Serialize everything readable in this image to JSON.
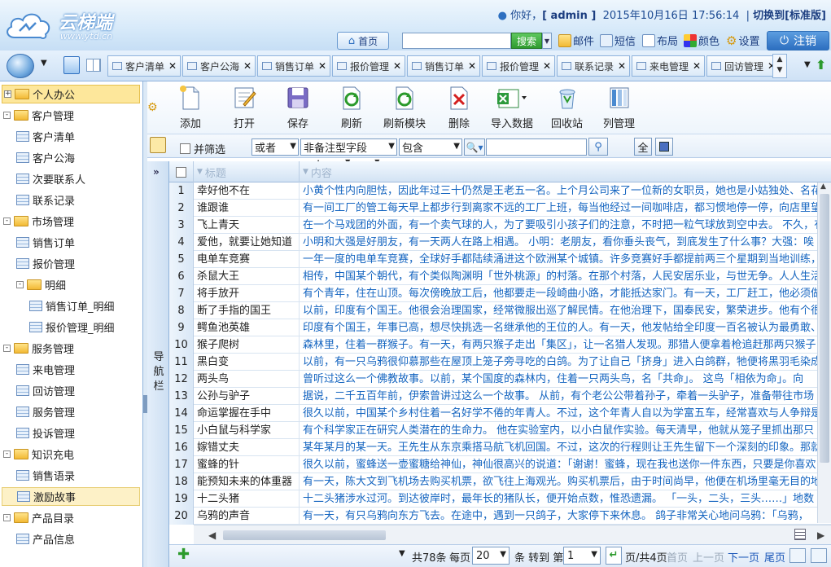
{
  "header": {
    "brand": "云梯端",
    "brand_url": "www.ytd.cn",
    "greeting": "你好，",
    "user": "[ admin ]",
    "datetime": "2015年10月16日 17:56:14",
    "switch_edition": "切换到[标准版]",
    "home": "首页",
    "search_placeholder": "",
    "search_button": "搜索",
    "mail": "邮件",
    "sms": "短信",
    "layout": "布局",
    "color": "颜色",
    "settings": "设置",
    "logout": "注销"
  },
  "tabs": [
    "客户清单",
    "客户公海",
    "销售订单",
    "报价管理",
    "销售订单",
    "报价管理",
    "联系记录",
    "来电管理",
    "回访管理"
  ],
  "sidebar": {
    "items": [
      {
        "label": "个人办公",
        "type": "folder",
        "level": 0,
        "expander": "+",
        "selected": true
      },
      {
        "label": "客户管理",
        "type": "folder",
        "level": 0,
        "expander": "-"
      },
      {
        "label": "客户清单",
        "type": "page",
        "level": 1
      },
      {
        "label": "客户公海",
        "type": "page",
        "level": 1
      },
      {
        "label": "次要联系人",
        "type": "page",
        "level": 1
      },
      {
        "label": "联系记录",
        "type": "page",
        "level": 1
      },
      {
        "label": "市场管理",
        "type": "folder",
        "level": 0,
        "expander": "-"
      },
      {
        "label": "销售订单",
        "type": "page",
        "level": 1
      },
      {
        "label": "报价管理",
        "type": "page",
        "level": 1
      },
      {
        "label": "明细",
        "type": "folder",
        "level": 1,
        "expander": "-"
      },
      {
        "label": "销售订单_明细",
        "type": "page",
        "level": 2
      },
      {
        "label": "报价管理_明细",
        "type": "page",
        "level": 2
      },
      {
        "label": "服务管理",
        "type": "folder",
        "level": 0,
        "expander": "-"
      },
      {
        "label": "来电管理",
        "type": "page",
        "level": 1
      },
      {
        "label": "回访管理",
        "type": "page",
        "level": 1
      },
      {
        "label": "服务管理",
        "type": "page",
        "level": 1
      },
      {
        "label": "投诉管理",
        "type": "page",
        "level": 1
      },
      {
        "label": "知识充电",
        "type": "folder",
        "level": 0,
        "expander": "-"
      },
      {
        "label": "销售语录",
        "type": "page",
        "level": 1
      },
      {
        "label": "激励故事",
        "type": "page",
        "level": 1,
        "highlighted": true
      },
      {
        "label": "产品目录",
        "type": "folder",
        "level": 0,
        "expander": "-"
      },
      {
        "label": "产品信息",
        "type": "page",
        "level": 1
      }
    ]
  },
  "toolbar": {
    "add": "添加",
    "open": "打开",
    "save": "保存",
    "refresh": "刷新",
    "refresh_module": "刷新模块",
    "delete": "删除",
    "import": "导入数据",
    "recycle": "回收站",
    "columns": "列管理"
  },
  "filter": {
    "concurrent": "并筛选",
    "logic": "或者",
    "field": "非备注型字段",
    "operator": "包含",
    "value": "",
    "all_button": "全"
  },
  "navcol": {
    "label": "导航栏"
  },
  "grid": {
    "columns": [
      "标题",
      "内容"
    ],
    "rows": [
      {
        "n": "1",
        "title": "幸好他不在",
        "content": "小黄个性内向胆怯，因此年过三十仍然是王老五一名。上个月公司来了一位新的女职员，她也是小姑独处、名花"
      },
      {
        "n": "2",
        "title": "谁跟谁",
        "content": "有一间工厂的管工每天早上都步行到离家不远的工厂上班，每当他经过一间咖啡店，都习惯地停一停，向店里望"
      },
      {
        "n": "3",
        "title": "飞上青天",
        "content": "在一个马戏团的外面，有一个卖气球的人，为了要吸引小孩子们的注意，不时把一粒气球放到空中去。 不久，有"
      },
      {
        "n": "4",
        "title": "爱他，就要让她知道",
        "content": "小明和大强是好朋友，有一天两人在路上相遇。 小明：老朋友，看你垂头丧气，到底发生了什么事？大强：唉"
      },
      {
        "n": "5",
        "title": "电单车竞赛",
        "content": "一年一度的电单车竞赛，全球好手都陆续涌进这个欧洲某个城镇。许多竞赛好手都提前两三个星期到当地训练，"
      },
      {
        "n": "6",
        "title": "杀鼠大王",
        "content": "相传，中国某个朝代，有个类似陶渊明「世外桃源」的村落。在那个村落，人民安居乐业，与世无争。人人生活"
      },
      {
        "n": "7",
        "title": "将手放开",
        "content": "有个青年，住在山顶。每次傍晚放工后，他都要走一段崎曲小路，才能抵达家门。有一天，工厂赶工，他必须做"
      },
      {
        "n": "8",
        "title": "断了手指的国王",
        "content": "以前，印度有个国王。他很会治理国家，经常微服出巡了解民情。在他治理下，国泰民安，繁荣进步。他有个很"
      },
      {
        "n": "9",
        "title": "鳄鱼池英雄",
        "content": "印度有个国王，年事已高，想尽快挑选一名继承他的王位的人。有一天，他发帖给全印度一百名被认为最勇敢、"
      },
      {
        "n": "10",
        "title": "猴子爬树",
        "content": "森林里，住着一群猴子。有一天，有两只猴子走出「集区」，让一名猎人发现。那猎人便拿着枪追赶那两只猴子"
      },
      {
        "n": "11",
        "title": "黑白变",
        "content": "以前，有一只乌鸦很仰慕那些在屋顶上笼子旁寻吃的白鸽。为了让自己「挤身」进入白鸽群，牠便将黑羽毛染成"
      },
      {
        "n": "12",
        "title": "两头鸟",
        "content": "曾听过这么一个佛教故事。以前，某个国度的森林内，住着一只两头鸟，名「共命」。 这鸟「相依为命」。向"
      },
      {
        "n": "13",
        "title": "公孙与驴子",
        "content": "据说，二千五百年前，伊索曾讲过这么一个故事。 从前，有个老公公带着孙子，牵着一头驴子，准备带往市场"
      },
      {
        "n": "14",
        "title": "命运掌握在手中",
        "content": "很久以前，中国某个乡村住着一名好学不倦的年青人。不过，这个年青人自以为学富五车，经常喜欢与人争辩是"
      },
      {
        "n": "15",
        "title": "小白鼠与科学家",
        "content": "有个科学家正在研究人类潜在的生命力。 他在实验室内，以小白鼠作实验。每天清早，他就从笼子里抓出那只"
      },
      {
        "n": "16",
        "title": "嫁错丈夫",
        "content": "某年某月的某一天。王先生从东京乘搭马航飞机回国。不过，这次的行程则让王先生留下一个深刻的印象。那就"
      },
      {
        "n": "17",
        "title": "蜜蜂的针",
        "content": "很久以前，蜜蜂送一壶蜜糖给神仙，神仙很高兴的说道：「谢谢！蜜蜂，现在我也送你一件东西，只要是你喜欢"
      },
      {
        "n": "18",
        "title": "能预知未来的体重器",
        "content": "有一天，陈大文到飞机场去购买机票，欲飞往上海观光。购买机票后，由于时间尚早，他便在机场里毫无目的地"
      },
      {
        "n": "19",
        "title": "十二头猪",
        "content": "十二头猪涉水过河。到达彼岸时，最年长的猪队长，便开始点数，惟恐遗漏。 「一头，二头，三头……」地数"
      },
      {
        "n": "20",
        "title": "乌鸦的声音",
        "content": "有一天，有只乌鸦向东方飞去。在途中，遇到一只鸽子，大家停下来休息。 鸽子非常关心地问乌鸦：「乌鸦，"
      }
    ]
  },
  "pager": {
    "total": "共78条",
    "per_page_label": "每页",
    "per_page": "20",
    "goto_label": "条 转到 第",
    "page": "1",
    "page_total": "页/共4页",
    "first": "首页",
    "prev": "上一页",
    "next": "下一页",
    "last": "尾页"
  },
  "colors": {
    "accent": "#2d6fc0",
    "link": "#1565c0",
    "selected": "#fde79b"
  }
}
